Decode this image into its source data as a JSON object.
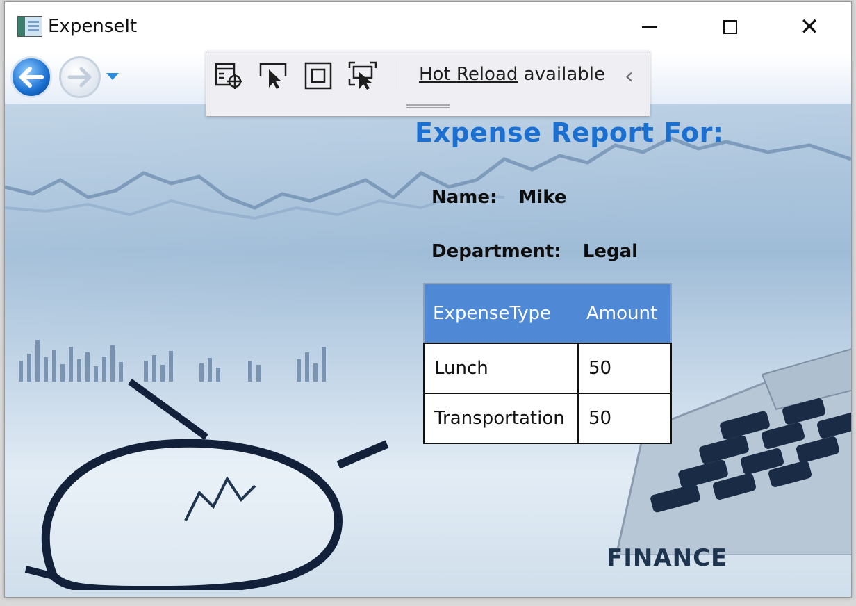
{
  "window": {
    "title": "ExpenseIt",
    "minimize_label": "—",
    "maximize_label": "☐",
    "close_label": "✕"
  },
  "navigation": {
    "back_icon": "back-arrow-icon",
    "forward_icon": "forward-arrow-icon",
    "dropdown_icon": "chevron-down-icon"
  },
  "hot_reload_toolbar": {
    "link_text": "Hot Reload",
    "status_text": " available",
    "icons": [
      "select-element-icon",
      "pointer-select-icon",
      "display-layout-adorners-icon",
      "track-focus-icon"
    ],
    "collapse_icon": "chevron-left-icon"
  },
  "report": {
    "heading": "Expense Report For:",
    "name_label": "Name:",
    "name_value": "Mike",
    "department_label": "Department:",
    "department_value": "Legal",
    "table": {
      "columns": [
        "ExpenseType",
        "Amount"
      ],
      "rows": [
        {
          "type": "Lunch",
          "amount": "50"
        },
        {
          "type": "Transportation",
          "amount": "50"
        }
      ]
    },
    "background_caption": "FINANCE"
  },
  "colors": {
    "heading_blue": "#1a6fd0",
    "table_header": "#4f89d6",
    "finance_text": "#1e3550"
  }
}
